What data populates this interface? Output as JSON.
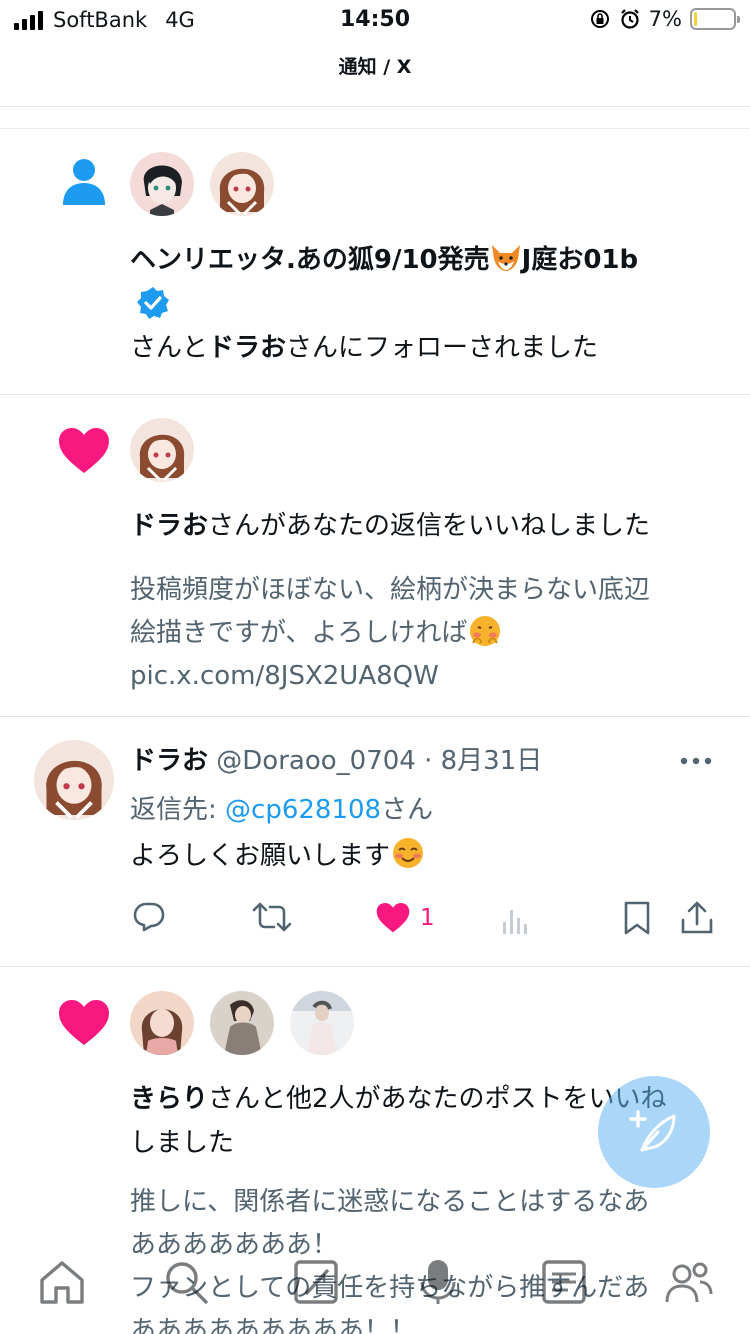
{
  "status": {
    "carrier": "SoftBank",
    "network": "4G",
    "time": "14:50",
    "battery": "7%",
    "battery_fraction": 0.07
  },
  "header": {
    "title": "通知 / X"
  },
  "notifications": [
    {
      "type": "follow",
      "user1": "ヘンリエッタ.あの狐9/10発売",
      "user1_suffix": "J庭お01b",
      "user1_emoji": "fox-emoji",
      "text_a": "さんと",
      "user2": "ドラお",
      "text_b": "さんにフォローされました"
    },
    {
      "type": "like",
      "user": "ドラお",
      "text": "さんがあなたの返信をいいねしました",
      "snippet_line1": "投稿頻度がほぼない、絵柄が決まらない底辺",
      "snippet_line2": "絵描きですが、よろしければ",
      "snippet_emoji": "shy-face-emoji",
      "snippet_line3": "pic.x.com/8JSX2UA8QW"
    },
    {
      "type": "reply",
      "name": "ドラお",
      "handle": "@Doraoo_0704",
      "sep": "·",
      "date": "8月31日",
      "reply_to_label": "返信先:",
      "reply_to_handle": "@cp628108",
      "reply_to_suffix": "さん",
      "body": "よろしくお願いします",
      "body_emoji": "smiling-face-emoji",
      "like_count": "1"
    },
    {
      "type": "like",
      "user": "きらり",
      "text": "さんと他2人があなたのポストをいいね",
      "text2": "しました",
      "snippet_line1": "推しに、関係者に迷惑になることはするなあ",
      "snippet_line2": "あああああああ！",
      "snippet_line3": "ファンとしての責任を持ちながら推すんだあ",
      "snippet_line4": "あああああああああ！！"
    }
  ],
  "colors": {
    "accent": "#1d9bf0",
    "like": "#f91880",
    "text": "#0f1419",
    "muted": "#536471"
  }
}
